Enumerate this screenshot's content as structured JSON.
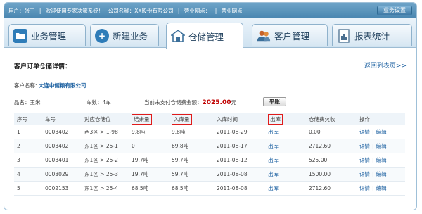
{
  "topbar": {
    "info": [
      "用户：张三",
      "|",
      "欢迎使用专家决策系统！",
      "公司名称：XX股份有限公司",
      "|",
      "营业网点：",
      "|",
      "营业网点"
    ],
    "settings_label": "业务设置"
  },
  "tabs": [
    {
      "label": "业务管理",
      "icon": "folder-icon",
      "color": "#2e7cb8"
    },
    {
      "label": "新建业务",
      "icon": "plus-icon",
      "color": "#2e7cb8"
    },
    {
      "label": "仓储管理",
      "icon": "warehouse-icon",
      "color": "#3b6f9a",
      "active": true
    },
    {
      "label": "客户管理",
      "icon": "users-icon",
      "color": "#c5622a"
    },
    {
      "label": "报表统计",
      "icon": "report-icon",
      "color": "#4a6f8f"
    }
  ],
  "page": {
    "title": "客户订单仓储详情：",
    "back_link": "返回列表页>>"
  },
  "customer": {
    "label": "客户名称:",
    "name": "大连中储粮有限公司"
  },
  "meta": {
    "product_label": "品名：玉米",
    "car_count_label": "车数：4车",
    "fee_label": "当前未支付仓储费金额：",
    "fee_amount": "2025.00",
    "fee_unit": "元",
    "settle_label": "平账"
  },
  "table": {
    "headers": [
      "序号",
      "车号",
      "对应仓储位",
      "结余量",
      "入库量",
      "入库时间",
      "出库",
      "仓储费欠收",
      "操作"
    ],
    "highlighted_headers": [
      3,
      4,
      6
    ],
    "rows": [
      {
        "seq": "1",
        "car": "0003402",
        "slot": "西3区 > 1-98",
        "balance": "9.8吨",
        "inbound": "9.8吨",
        "time": "2011-08-29",
        "out": "出库",
        "fee": "0.00",
        "fee_red": false,
        "detail": "详情",
        "edit": "编辑"
      },
      {
        "seq": "2",
        "car": "0003402",
        "slot": "东1区 > 25-1",
        "balance": "0",
        "inbound": "69.8吨",
        "time": "2011-08-17",
        "out": "出库",
        "fee": "2712.60",
        "fee_red": true,
        "detail": "详情",
        "edit": "编辑"
      },
      {
        "seq": "3",
        "car": "0003401",
        "slot": "东1区 > 25-2",
        "balance": "19.7吨",
        "inbound": "59.7吨",
        "time": "2011-08-12",
        "out": "出库",
        "fee": "525.00",
        "fee_red": true,
        "detail": "详情",
        "edit": "编辑"
      },
      {
        "seq": "4",
        "car": "0003029",
        "slot": "东1区 > 25-3",
        "balance": "19.7吨",
        "inbound": "59.7吨",
        "time": "2011-08-08",
        "out": "出库",
        "fee": "1500.00",
        "fee_red": true,
        "detail": "详情",
        "edit": "编辑"
      },
      {
        "seq": "5",
        "car": "0002153",
        "slot": "东1区 > 25-4",
        "balance": "68.5吨",
        "inbound": "68.5吨",
        "time": "2011-08-08",
        "out": "出库",
        "fee": "2712.60",
        "fee_red": true,
        "detail": "详情",
        "edit": "编辑"
      }
    ]
  }
}
